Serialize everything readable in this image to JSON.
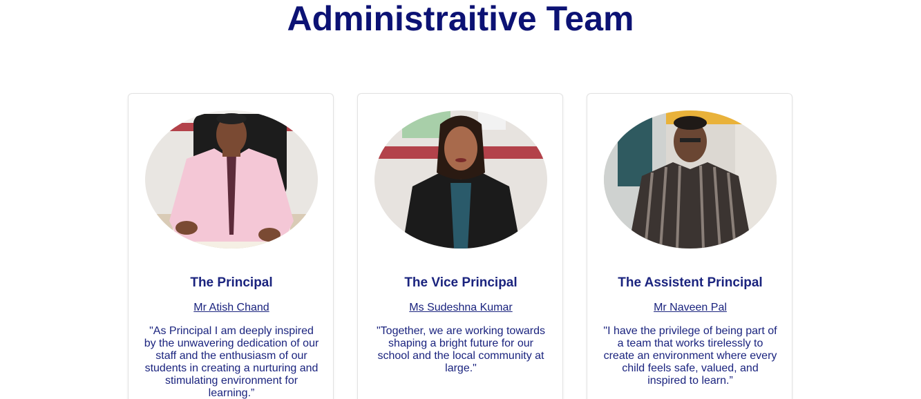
{
  "section": {
    "title": "Administraitive Team"
  },
  "team": [
    {
      "role": "The Principal",
      "name": "Mr Atish Chand",
      "quote": "\"As Principal I am deeply inspired by the unwavering dedication of our staff and the enthusiasm of our students in creating a nurturing and stimulating environment for learning.”"
    },
    {
      "role": "The Vice Principal",
      "name": "Ms Sudeshna Kumar",
      "quote": "\"Together, we are working towards shaping a bright future for our school and the local community at large.\""
    },
    {
      "role": "The Assistent Principal",
      "name": "Mr Naveen Pal",
      "quote": "\"I have the privilege of being part of a team that works tirelessly to create an environment where every child feels safe, valued, and inspired to learn.”"
    }
  ],
  "colors": {
    "title": "#0c1274",
    "text": "#1a237e",
    "card_border": "#e2e2e2"
  }
}
